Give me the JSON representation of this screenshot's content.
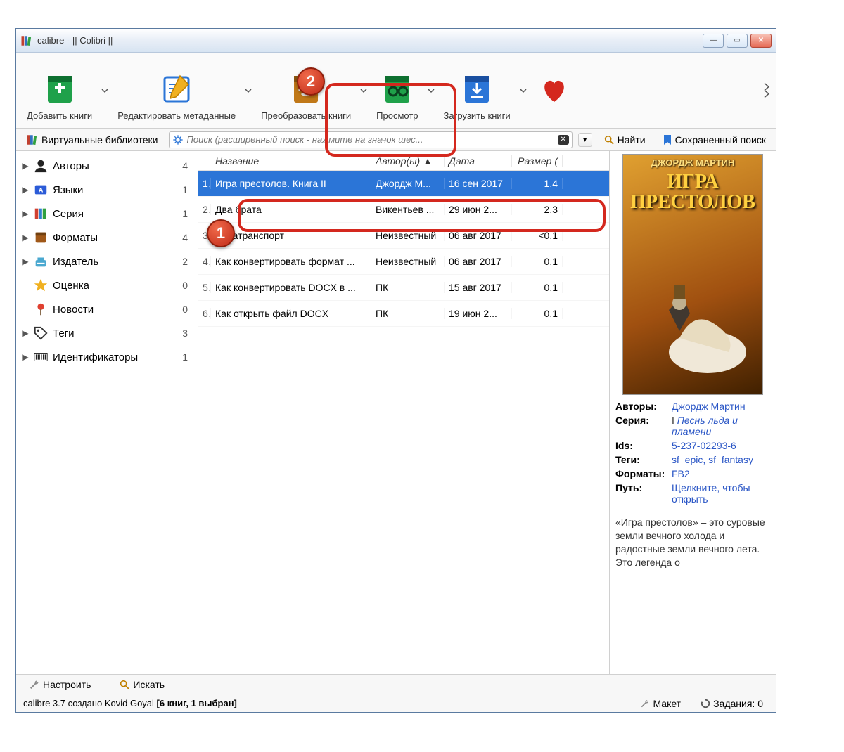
{
  "window_title": "calibre - || Colibri ||",
  "toolbar": [
    {
      "label": "Добавить книги",
      "icon": "add-book"
    },
    {
      "label": "Редактировать метаданные",
      "icon": "edit-meta"
    },
    {
      "label": "Преобразовать книги",
      "icon": "convert"
    },
    {
      "label": "Просмотр",
      "icon": "view"
    },
    {
      "label": "Загрузить книги",
      "icon": "download"
    },
    {
      "label": "",
      "icon": "heart"
    }
  ],
  "subbar": {
    "virtual_lib": "Виртуальные библиотеки",
    "search_placeholder": "Поиск (расширенный поиск - нажмите на значок шес...",
    "find": "Найти",
    "saved_search": "Сохраненный поиск"
  },
  "sidebar": [
    {
      "caret": "▶",
      "icon": "author",
      "label": "Авторы",
      "count": "4"
    },
    {
      "caret": "▶",
      "icon": "lang",
      "label": "Языки",
      "count": "1"
    },
    {
      "caret": "▶",
      "icon": "series",
      "label": "Серия",
      "count": "1"
    },
    {
      "caret": "▶",
      "icon": "format",
      "label": "Форматы",
      "count": "4"
    },
    {
      "caret": "▶",
      "icon": "publisher",
      "label": "Издатель",
      "count": "2"
    },
    {
      "caret": "",
      "icon": "rating",
      "label": "Оценка",
      "count": "0"
    },
    {
      "caret": "",
      "icon": "news",
      "label": "Новости",
      "count": "0"
    },
    {
      "caret": "▶",
      "icon": "tag",
      "label": "Теги",
      "count": "3"
    },
    {
      "caret": "▶",
      "icon": "id",
      "label": "Идентификаторы",
      "count": "1"
    }
  ],
  "columns": {
    "title": "Название",
    "author": "Автор(ы)",
    "date": "Дата",
    "size": "Размер ("
  },
  "books": [
    {
      "num": "1",
      "title": "Игра престолов. Книга II",
      "author": "Джордж М...",
      "date": "16 сен 2017",
      "size": "1.4",
      "sel": true
    },
    {
      "num": "2",
      "title": "Два брата",
      "author": "Викентьев ...",
      "date": "29 июн 2...",
      "size": "2.3"
    },
    {
      "num": "3",
      "title": "Авиатранспорт",
      "author": "Неизвестный",
      "date": "06 авг 2017",
      "size": "<0.1"
    },
    {
      "num": "4",
      "title": "Как конвертировать формат ...",
      "author": "Неизвестный",
      "date": "06 авг 2017",
      "size": "0.1"
    },
    {
      "num": "5",
      "title": "Как конвертировать DOCX в ...",
      "author": "ПК",
      "date": "15 авг 2017",
      "size": "0.1"
    },
    {
      "num": "6",
      "title": "Как открыть файл DOCX",
      "author": "ПК",
      "date": "19 июн 2...",
      "size": "0.1"
    }
  ],
  "cover": {
    "author": "ДЖОРДЖ МАРТИН",
    "title": "ИГРА\nПРЕСТОЛОВ"
  },
  "meta": {
    "authors_label": "Авторы:",
    "authors": "Джордж Мартин",
    "series_label": "Серия:",
    "series_prefix": "I ",
    "series": "Песнь льда и пламени",
    "ids_label": "Ids:",
    "ids": "5-237-02293-6",
    "tags_label": "Теги:",
    "tags": "sf_epic, sf_fantasy",
    "formats_label": "Форматы:",
    "formats": "FB2",
    "path_label": "Путь:",
    "path": "Щелкните, чтобы открыть"
  },
  "description": "«Игра престолов» – это суровые земли вечного холода и радостные земли вечного лета. Это легенда о",
  "bottom": {
    "configure": "Настроить",
    "search": "Искать"
  },
  "status": {
    "left_prefix": "calibre 3.7 создано Kovid Goyal   ",
    "left_bold": "[6 книг, 1 выбран]",
    "layout": "Макет",
    "jobs": "Задания: 0"
  },
  "callouts": {
    "1": "1",
    "2": "2"
  }
}
